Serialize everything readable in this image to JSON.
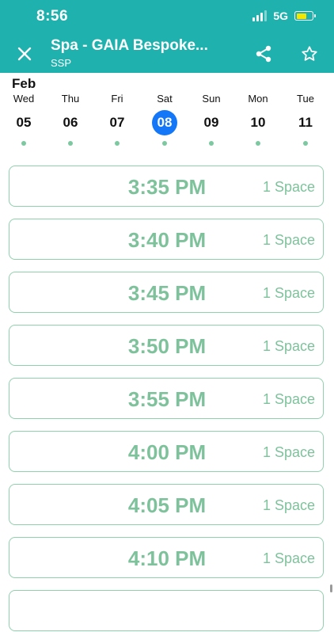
{
  "status_bar": {
    "time": "8:56",
    "network": "5G"
  },
  "header": {
    "title": "Spa - GAIA Bespoke...",
    "subtitle": "SSP",
    "background": "#1fb1ad"
  },
  "calendar": {
    "month": "Feb",
    "days": [
      {
        "dow": "Wed",
        "date": "05"
      },
      {
        "dow": "Thu",
        "date": "06"
      },
      {
        "dow": "Fri",
        "date": "07"
      },
      {
        "dow": "Sat",
        "date": "08",
        "selected": true
      },
      {
        "dow": "Sun",
        "date": "09"
      },
      {
        "dow": "Mon",
        "date": "10"
      },
      {
        "dow": "Tue",
        "date": "11"
      }
    ],
    "selected_color": "#1477f8"
  },
  "slots": [
    {
      "time": "3:35 PM",
      "availability": "1 Space"
    },
    {
      "time": "3:40 PM",
      "availability": "1 Space"
    },
    {
      "time": "3:45 PM",
      "availability": "1 Space"
    },
    {
      "time": "3:50 PM",
      "availability": "1 Space"
    },
    {
      "time": "3:55 PM",
      "availability": "1 Space"
    },
    {
      "time": "4:00 PM",
      "availability": "1 Space"
    },
    {
      "time": "4:05 PM",
      "availability": "1 Space"
    },
    {
      "time": "4:10 PM",
      "availability": "1 Space"
    },
    {
      "time": "",
      "availability": ""
    }
  ],
  "icons": [
    "close-icon",
    "share-icon",
    "star-icon"
  ]
}
